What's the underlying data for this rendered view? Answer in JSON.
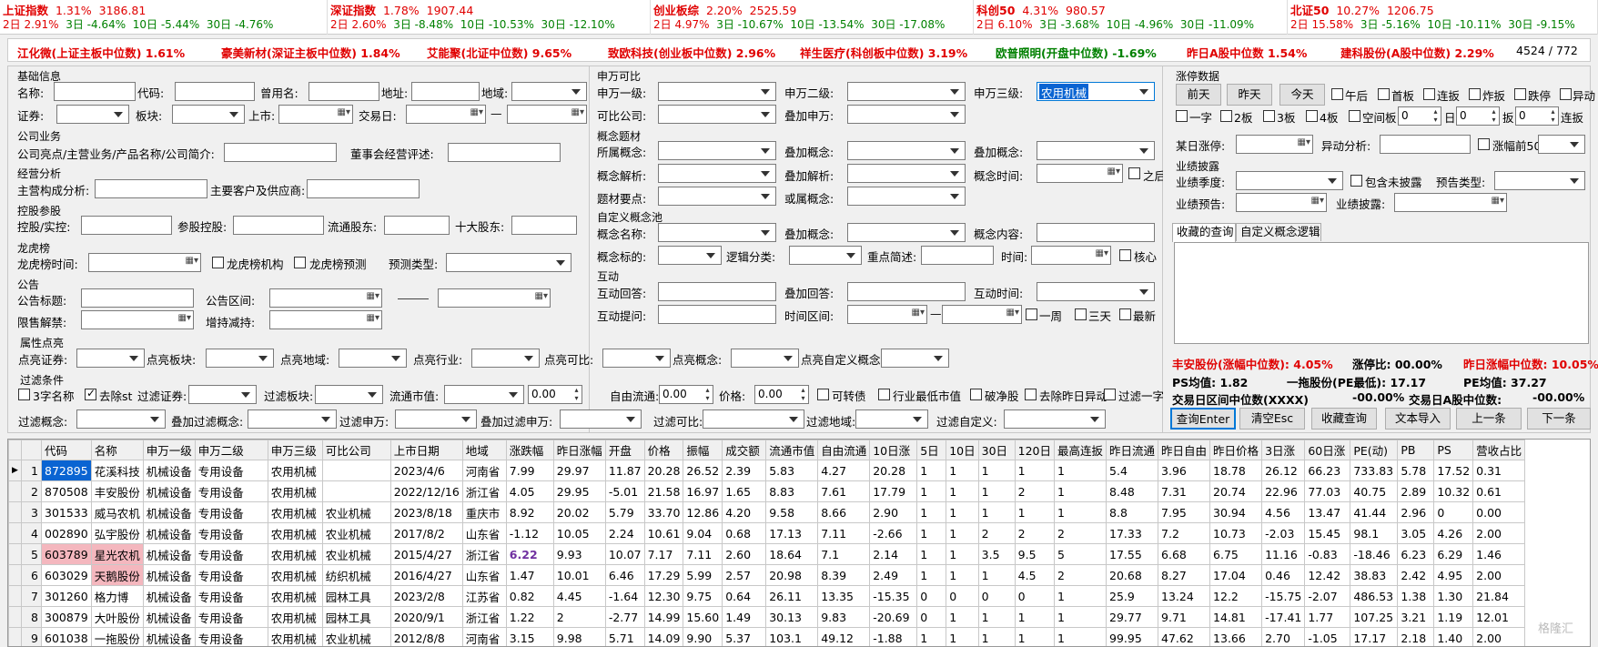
{
  "ticker": [
    {
      "name": "上证指数",
      "pct": "1.31%",
      "val": "3186.81",
      "d2": "2.91%",
      "d3": "-4.64%",
      "d10": "-5.44%",
      "d30": "-4.76%"
    },
    {
      "name": "深证指数",
      "pct": "1.78%",
      "val": "1907.44",
      "d2": "2.60%",
      "d3": "-8.48%",
      "d10": "-10.53%",
      "d30": "-12.10%"
    },
    {
      "name": "创业板综",
      "pct": "2.20%",
      "val": "2525.59",
      "d2": "4.97%",
      "d3": "-10.67%",
      "d10": "-13.54%",
      "d30": "-17.08%"
    },
    {
      "name": "科创50",
      "pct": "4.31%",
      "val": "980.57",
      "d2": "6.10%",
      "d3": "-3.68%",
      "d10": "-4.96%",
      "d30": "-11.09%"
    },
    {
      "name": "北证50",
      "pct": "10.27%",
      "val": "1206.75",
      "d2": "15.58%",
      "d3": "-5.16%",
      "d10": "-10.11%",
      "d30": "-9.15%"
    }
  ],
  "ticker_labels": {
    "d2": "2日",
    "d3": "3日",
    "d10": "10日",
    "d30": "30日"
  },
  "stats": {
    "s1": "江化微(上证主板中位数) 1.61%",
    "s2": "豪美新材(深证主板中位数) 1.84%",
    "s3": "艾能聚(北证中位数) 9.65%",
    "s4": "致欧科技(创业板中位数) 2.96%",
    "s5": "祥生医疗(科创板中位数) 3.19%",
    "s6": "欧普照明(开盘中位数) -1.69%",
    "s7": "昨日A股中位数 1.54%",
    "s8": "建科股份(A股中位数) 2.29%",
    "s9": "4524 / 772"
  },
  "left": {
    "basic": "基础信息",
    "name": "名称:",
    "code": "代码:",
    "used": "曾用名:",
    "addr": "地址:",
    "region": "地域:",
    "sec": "证券:",
    "board": "板块:",
    "list": "上市:",
    "tday": "交易日:",
    "dash": "—",
    "biz": "公司业务",
    "biz_l": "公司亮点/主营业务/产品名称/公司简介:",
    "board_l": "董事会经营评述:",
    "oper": "经营分析",
    "oper1": "主营构成分析:",
    "oper2": "主要客户及供应商:",
    "hold": "控股参股",
    "hold1": "控股/实控:",
    "hold2": "参股控股:",
    "hold3": "流通股东:",
    "hold4": "十大股东:",
    "lhb": "龙虎榜",
    "lhb1": "龙虎榜时间:",
    "lhb2": "龙虎榜机构",
    "lhb3": "龙虎榜预测",
    "lhb4": "预测类型:",
    "ann": "公告",
    "ann1": "公告标题:",
    "ann2": "公告区间:",
    "ann3": "限售解禁:",
    "ann4": "增持减持:"
  },
  "mid": {
    "sw": "申万可比",
    "sw1": "申万一级:",
    "sw2": "申万二级:",
    "sw3": "申万三级:",
    "sw3_val": "农用机械",
    "cmp": "可比公司:",
    "swadd": "叠加申万:",
    "concept": "概念题材",
    "c1": "所属概念:",
    "c2": "叠加概念:",
    "c3": "叠加概念:",
    "c4": "概念解析:",
    "c5": "叠加解析:",
    "c6": "概念时间:",
    "c7": "之后",
    "c8": "题材要点:",
    "c9": "或属概念:",
    "custom": "自定义概念池",
    "p1": "概念名称:",
    "p2": "叠加概念:",
    "p3": "概念内容:",
    "p4": "概念标的:",
    "p5": "逻辑分类:",
    "p6": "重点简述:",
    "p7": "时间:",
    "p8": "核心",
    "inter": "互动",
    "i1": "互动回答:",
    "i2": "叠加回答:",
    "i3": "互动时间:",
    "i4": "互动提问:",
    "i5": "时间区间:",
    "i6": "一周",
    "i7": "三天",
    "i8": "最新"
  },
  "right": {
    "limit": "涨停数据",
    "b1": "前天",
    "b2": "昨天",
    "b3": "今天",
    "k1": "午后",
    "k2": "首板",
    "k3": "连扳",
    "k4": "炸扳",
    "k5": "跌停",
    "k6": "异动",
    "k7": "一字",
    "k8": "2板",
    "k9": "3板",
    "k10": "4板",
    "k11": "空间板",
    "n1": "0",
    "n2": "日",
    "n3": "0",
    "n4": "扳",
    "n5": "0",
    "n6": "连扳",
    "r1": "某日涨停:",
    "r2": "异动分析:",
    "r3": "涨幅前50",
    "perf": "业绩披露",
    "f1": "业绩季度:",
    "f2": "包含未披露",
    "f3": "预告类型:",
    "f4": "业绩预告:",
    "f5": "业绩披露:",
    "tab1": "收藏的查询",
    "tab2": "自定义概念逻辑",
    "m1": "丰安股份(涨幅中位数): 4.05%",
    "m2": "涨停比: 00.00%",
    "m3": "昨日涨幅中位数: 10.05%",
    "m4": "PS均值: 1.82",
    "m5": "一拖股份(PE最低): 17.17",
    "m6": "PE均值: 37.27",
    "m7": "交易日区间中位数(XXXX)",
    "m8": "-00.00%",
    "m9": "交易日A股中位数:",
    "m10": "-00.00%",
    "q1": "查询Enter",
    "q2": "清空Esc",
    "q3": "收藏查询",
    "q4": "文本导入",
    "q5": "上一条",
    "q6": "下一条"
  },
  "attr": {
    "title": "属性点亮",
    "a1": "点亮证券:",
    "a2": "点亮板块:",
    "a3": "点亮地域:",
    "a4": "点亮行业:",
    "a5": "点亮可比:",
    "a6": "点亮概念:",
    "a7": "点亮自定义概念:"
  },
  "filter": {
    "title": "过滤条件",
    "f1": "3字名称",
    "f2": "去除st",
    "f3": "过滤证券:",
    "f4": "过滤板块:",
    "f5": "流通市值:",
    "f6": "0.00",
    "f7": "自由流通:",
    "f8": "0.00",
    "f9": "价格:",
    "f10": "0.00",
    "f11": "可转债",
    "f12": "行业最低市值",
    "f13": "破净股",
    "f14": "去除昨日异动",
    "f15": "过滤一字",
    "g1": "过滤概念:",
    "g2": "叠加过滤概念:",
    "g3": "过滤申万:",
    "g4": "叠加过滤申万:",
    "g5": "过滤可比:",
    "g6": "过滤地域:",
    "g7": "过滤自定义:"
  },
  "table": {
    "headers": [
      "",
      "代码",
      "名称",
      "申万一级",
      "申万二级",
      "申万三级",
      "可比公司",
      "上市日期",
      "地域",
      "涨跌幅",
      "昨日涨幅",
      "开盘",
      "价格",
      "振幅",
      "成交额",
      "流通市值",
      "自由流通",
      "10日涨",
      "5日",
      "10日",
      "30日",
      "120日",
      "最高连扳",
      "昨日流通",
      "昨日自由",
      "昨日价格",
      "3日涨",
      "60日涨",
      "PE(动)",
      "PB",
      "PS",
      "营收占比"
    ],
    "rows": [
      [
        "1",
        "872895",
        "花溪科技",
        "机械设备",
        "专用设备",
        "农用机械",
        "",
        "2023/4/6",
        "河南省",
        "7.99",
        "29.97",
        "11.87",
        "20.28",
        "26.52",
        "2.39",
        "5.83",
        "4.27",
        "20.28",
        "1",
        "1",
        "1",
        "1",
        "1",
        "5.4",
        "3.96",
        "18.78",
        "26.12",
        "66.23",
        "733.83",
        "5.78",
        "17.52",
        "0.31"
      ],
      [
        "2",
        "870508",
        "丰安股份",
        "机械设备",
        "专用设备",
        "农用机械",
        "",
        "2022/12/16",
        "浙江省",
        "4.05",
        "29.95",
        "-5.01",
        "21.58",
        "16.97",
        "1.65",
        "8.83",
        "7.61",
        "17.79",
        "1",
        "1",
        "1",
        "2",
        "1",
        "8.48",
        "7.31",
        "20.74",
        "22.96",
        "77.03",
        "40.75",
        "2.89",
        "10.32",
        "0.61"
      ],
      [
        "3",
        "301533",
        "威马农机",
        "机械设备",
        "专用设备",
        "农用机械",
        "农业机械",
        "2023/8/18",
        "重庆市",
        "8.92",
        "20.02",
        "5.79",
        "33.70",
        "12.86",
        "4.20",
        "9.58",
        "8.66",
        "2.90",
        "1",
        "1",
        "1",
        "1",
        "1",
        "8.8",
        "7.95",
        "30.94",
        "4.56",
        "13.47",
        "41.44",
        "2.96",
        "0",
        "0.00"
      ],
      [
        "4",
        "002890",
        "弘宇股份",
        "机械设备",
        "专用设备",
        "农用机械",
        "农业机械",
        "2017/8/2",
        "山东省",
        "-1.12",
        "10.05",
        "2.24",
        "10.61",
        "9.04",
        "0.68",
        "17.13",
        "7.11",
        "-2.66",
        "1",
        "1",
        "2",
        "2",
        "2",
        "17.33",
        "7.2",
        "10.73",
        "-2.03",
        "15.45",
        "98.1",
        "3.05",
        "4.26",
        "2.00"
      ],
      [
        "5",
        "603789",
        "星光农机",
        "机械设备",
        "专用设备",
        "农用机械",
        "农业机械",
        "2015/4/27",
        "浙江省",
        "6.22",
        "9.93",
        "10.07",
        "7.17",
        "7.11",
        "2.60",
        "18.64",
        "7.1",
        "2.14",
        "1",
        "1",
        "3.5",
        "9.5",
        "5",
        "17.55",
        "6.68",
        "6.75",
        "11.16",
        "-0.83",
        "-18.46",
        "6.23",
        "6.29",
        "1.46"
      ],
      [
        "6",
        "603029",
        "天鹅股份",
        "机械设备",
        "专用设备",
        "农用机械",
        "纺织机械",
        "2016/4/27",
        "山东省",
        "1.47",
        "10.01",
        "6.46",
        "17.29",
        "5.99",
        "2.57",
        "20.98",
        "8.39",
        "2.49",
        "1",
        "1",
        "1",
        "4.5",
        "2",
        "20.68",
        "8.27",
        "17.04",
        "0.46",
        "12.42",
        "38.83",
        "2.42",
        "4.95",
        "2.00"
      ],
      [
        "7",
        "301260",
        "格力博",
        "机械设备",
        "专用设备",
        "农用机械",
        "园林工具",
        "2023/2/8",
        "江苏省",
        "0.82",
        "4.45",
        "-1.64",
        "12.30",
        "9.75",
        "0.64",
        "26.11",
        "13.35",
        "-15.35",
        "0",
        "0",
        "0",
        "0",
        "1",
        "25.9",
        "13.24",
        "12.2",
        "-15.75",
        "-2.07",
        "486.53",
        "1.38",
        "1.30",
        "21.84"
      ],
      [
        "8",
        "300879",
        "大叶股份",
        "机械设备",
        "专用设备",
        "农用机械",
        "园林工具",
        "2020/9/1",
        "浙江省",
        "1.22",
        "2",
        "-2.77",
        "14.99",
        "15.60",
        "1.49",
        "30.13",
        "9.83",
        "-20.69",
        "0",
        "1",
        "1",
        "1",
        "1",
        "29.77",
        "9.71",
        "14.81",
        "-17.41",
        "1.77",
        "107.25",
        "3.21",
        "1.19",
        "12.01"
      ],
      [
        "9",
        "601038",
        "一拖股份",
        "机械设备",
        "专用设备",
        "农用机械",
        "农业机械",
        "2012/8/8",
        "河南省",
        "3.15",
        "9.98",
        "5.71",
        "14.09",
        "9.90",
        "5.37",
        "103.1",
        "49.12",
        "-1.88",
        "1",
        "1",
        "1",
        "1",
        "1",
        "99.95",
        "47.62",
        "13.66",
        "2.70",
        "-1.05",
        "17.17",
        "2.18",
        "1.40",
        "2.00"
      ]
    ]
  },
  "watermark": "格隆汇"
}
